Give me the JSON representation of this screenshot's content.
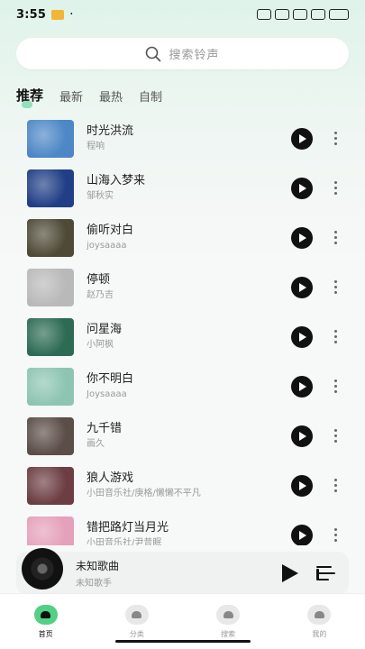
{
  "status_bar": {
    "time": "3:55"
  },
  "search": {
    "placeholder": "搜索铃声"
  },
  "tabs": [
    {
      "label": "推荐",
      "active": true
    },
    {
      "label": "最新",
      "active": false
    },
    {
      "label": "最热",
      "active": false
    },
    {
      "label": "自制",
      "active": false
    }
  ],
  "songs": [
    {
      "title": "时光洪流",
      "artist": "程响",
      "cover_color": "#4d87c6"
    },
    {
      "title": "山海入梦来",
      "artist": "邹秋实",
      "cover_color": "#213f86"
    },
    {
      "title": "偷听对白",
      "artist": "joysaaaa",
      "cover_color": "#4f4a37"
    },
    {
      "title": "停顿",
      "artist": "赵乃吉",
      "cover_color": "#b9b9b9"
    },
    {
      "title": "问星海",
      "artist": "小阿枫",
      "cover_color": "#2d6b55"
    },
    {
      "title": "你不明白",
      "artist": "Joysaaaa",
      "cover_color": "#8ec5b2"
    },
    {
      "title": "九千错",
      "artist": "画久",
      "cover_color": "#5b4d47"
    },
    {
      "title": "狼人游戏",
      "artist": "小田音乐社/庚格/懒懒不平凡",
      "cover_color": "#6c3e43"
    },
    {
      "title": "错把路灯当月光",
      "artist": "小田音乐社/尹昔眠",
      "cover_color": "#e5a0ba"
    }
  ],
  "mini_player": {
    "title": "未知歌曲",
    "artist": "未知歌手"
  },
  "bottom_nav": [
    {
      "label": "首页",
      "icon": "home-icon",
      "active": true
    },
    {
      "label": "分类",
      "icon": "category-icon",
      "active": false
    },
    {
      "label": "搜索",
      "icon": "search-icon",
      "active": false
    },
    {
      "label": "我的",
      "icon": "profile-icon",
      "active": false
    }
  ],
  "colors": {
    "accent": "#52d083",
    "text": "#111111",
    "secondary": "#999999"
  }
}
